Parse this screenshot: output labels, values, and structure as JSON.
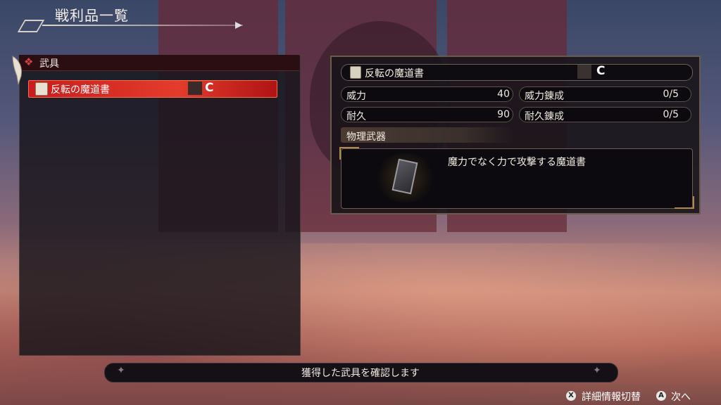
{
  "screen": {
    "title": "戦利品一覧"
  },
  "list": {
    "category": "武具",
    "items": [
      {
        "name": "反転の魔道書",
        "selected": true
      }
    ]
  },
  "detail": {
    "name": "反転の魔道書",
    "stats": [
      {
        "label": "威力",
        "value": "40"
      },
      {
        "label": "威力錬成",
        "value": "0/5"
      },
      {
        "label": "耐久",
        "value": "90"
      },
      {
        "label": "耐久錬成",
        "value": "0/5"
      }
    ],
    "type": "物理武器",
    "description": "魔力でなく力で攻撃する魔道書"
  },
  "hint": "獲得した武具を確認します",
  "controls": [
    {
      "button": "X",
      "label": "詳細情報切替"
    },
    {
      "button": "A",
      "label": "次へ"
    }
  ],
  "colors": {
    "selected_row": "#d9281f",
    "accent_gold": "#b08a4a"
  }
}
